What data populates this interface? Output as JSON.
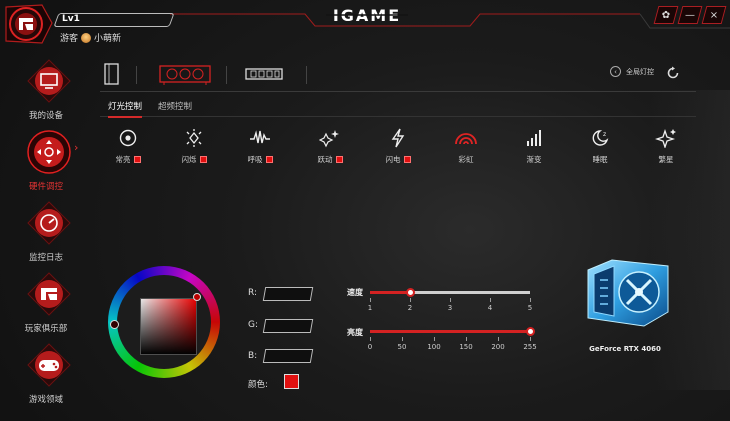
{
  "header": {
    "level": "Lv1",
    "user_prefix": "游客",
    "username": "小萌新",
    "brand": "IGAME",
    "window_buttons": [
      "settings",
      "minimize",
      "close"
    ]
  },
  "sidebar": {
    "items": [
      {
        "label": "我的设备",
        "icon": "monitor-icon",
        "active": false
      },
      {
        "label": "硬件调控",
        "icon": "dpad-icon",
        "active": true
      },
      {
        "label": "监控日志",
        "icon": "monitor-gauge-icon",
        "active": false
      },
      {
        "label": "玩家俱乐部",
        "icon": "igame-club-icon",
        "active": false
      },
      {
        "label": "游戏领域",
        "icon": "gamepad-icon",
        "active": false
      }
    ]
  },
  "devices": {
    "items": [
      "pc-case-icon",
      "gpu-card-icon",
      "memory-module-icon"
    ],
    "selected": 1,
    "all_light_label": "全局灯控"
  },
  "tabs": [
    {
      "label": "灯光控制",
      "active": true
    },
    {
      "label": "超频控制",
      "active": false
    }
  ],
  "light_modes": [
    {
      "label": "常亮",
      "icon": "target-icon",
      "has_color": true
    },
    {
      "label": "闪烁",
      "icon": "flash-burst-icon",
      "has_color": true
    },
    {
      "label": "呼吸",
      "icon": "breathe-wave-icon",
      "has_color": true
    },
    {
      "label": "跃动",
      "icon": "sparkle-jump-icon",
      "has_color": true
    },
    {
      "label": "闪电",
      "icon": "lightning-icon",
      "has_color": true
    },
    {
      "label": "彩虹",
      "icon": "rainbow-icon",
      "has_color": false,
      "active": true
    },
    {
      "label": "渐变",
      "icon": "signal-bars-icon",
      "has_color": false
    },
    {
      "label": "睡眠",
      "icon": "moon-sleep-icon",
      "has_color": false
    },
    {
      "label": "繁星",
      "icon": "stars-icon",
      "has_color": false
    }
  ],
  "color": {
    "r_label": "R:",
    "g_label": "G:",
    "b_label": "B:",
    "r_value": "",
    "g_value": "",
    "b_value": "",
    "color_label": "颜色:",
    "current_hex": "#e01010"
  },
  "speed": {
    "label": "速度",
    "ticks": [
      "1",
      "2",
      "3",
      "4",
      "5"
    ],
    "value": 2,
    "min": 1,
    "max": 5
  },
  "brightness": {
    "label": "亮度",
    "ticks": [
      "0",
      "50",
      "100",
      "150",
      "200",
      "255"
    ],
    "value": 255,
    "min": 0,
    "max": 255
  },
  "gpu": {
    "name": "GeForce RTX 4060"
  },
  "colors": {
    "accent": "#d42222",
    "bg": "#1b1b1b",
    "gpu_blue": "#3fb4f0"
  }
}
